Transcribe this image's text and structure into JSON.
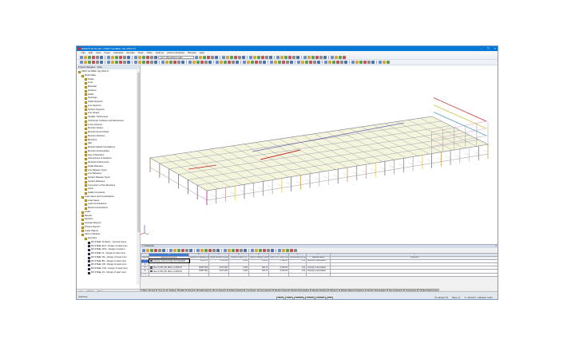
{
  "window": {
    "title": "RFEM 5.22.01 x64 - [ORZY-GLOBAL July 2019 A*]",
    "controls": [
      "–",
      "❐",
      "✕"
    ]
  },
  "menu": [
    "File",
    "Edit",
    "View",
    "Insert",
    "Calculate",
    "Results",
    "Tools",
    "Table",
    "Options",
    "Add-on Modules",
    "Window",
    "Help"
  ],
  "toolbar": {
    "load_case": "LC7 - Permanent Loads"
  },
  "navigator": {
    "title": "Project Navigator - Data",
    "items": [
      {
        "label": "ORZY-GLOBAL July 2019 A*",
        "level": 0,
        "type": "root"
      },
      {
        "label": "Model Data",
        "level": 1
      },
      {
        "label": "Nodes",
        "level": 2
      },
      {
        "label": "Lines",
        "level": 2
      },
      {
        "label": "Materials",
        "level": 2
      },
      {
        "label": "Surfaces",
        "level": 2
      },
      {
        "label": "Solids",
        "level": 2
      },
      {
        "label": "Openings",
        "level": 2
      },
      {
        "label": "Nodal Supports",
        "level": 2
      },
      {
        "label": "Line Supports",
        "level": 2
      },
      {
        "label": "Surface Supports",
        "level": 2
      },
      {
        "label": "Line Hinges",
        "level": 2
      },
      {
        "label": "Variable Thicknesses",
        "level": 2
      },
      {
        "label": "Orthotropic Surfaces and Membranes",
        "level": 2
      },
      {
        "label": "Cross-Sections",
        "level": 2
      },
      {
        "label": "Member Hinges",
        "level": 2
      },
      {
        "label": "Member Eccentricities",
        "level": 2
      },
      {
        "label": "Member Divisions",
        "level": 2
      },
      {
        "label": "Members",
        "level": 2
      },
      {
        "label": "Ribs",
        "level": 2
      },
      {
        "label": "Member Elastic Foundations",
        "level": 2
      },
      {
        "label": "Member Nonlinearities",
        "level": 2
      },
      {
        "label": "Sets of Members",
        "level": 2
      },
      {
        "label": "Intersections of Surfaces",
        "level": 2
      },
      {
        "label": "FE Mesh Refinements",
        "level": 2
      },
      {
        "label": "Nodal Releases",
        "level": 2
      },
      {
        "label": "Line Release Types",
        "level": 2
      },
      {
        "label": "Line Releases",
        "level": 2
      },
      {
        "label": "Surface Release Types",
        "level": 2
      },
      {
        "label": "Surface Releases",
        "level": 2
      },
      {
        "label": "Connection of Two Members",
        "level": 2
      },
      {
        "label": "Joints",
        "level": 2
      },
      {
        "label": "Nodal Constraints",
        "level": 2
      },
      {
        "label": "Load Cases and Combinations",
        "level": 1
      },
      {
        "label": "Load Cases",
        "level": 2
      },
      {
        "label": "Load Combinations",
        "level": 2
      },
      {
        "label": "Result Combinations",
        "level": 2
      },
      {
        "label": "Loads",
        "level": 1
      },
      {
        "label": "Results",
        "level": 1
      },
      {
        "label": "Sections",
        "level": 1
      },
      {
        "label": "Average Regions",
        "level": 1
      },
      {
        "label": "Printout Reports",
        "level": 1
      },
      {
        "label": "Guide Objects",
        "level": 1
      },
      {
        "label": "Add-on Modules",
        "level": 1
      },
      {
        "label": "Favorites",
        "level": 2
      },
      {
        "label": "RF-STEEL Surfaces - General stress",
        "level": 3,
        "type": "module"
      },
      {
        "label": "RF-STEEL EC3 - Design of steel mem",
        "level": 3,
        "type": "module"
      },
      {
        "label": "RF-STEEL AISC - Design of steel m",
        "level": 3,
        "type": "module"
      },
      {
        "label": "RF-STEEL IS - Design of steel mem",
        "level": 3,
        "type": "module"
      },
      {
        "label": "RF-STEEL SIA - Design of steel mem",
        "level": 3,
        "type": "module"
      },
      {
        "label": "RF-STEEL BS - Design of steel mem",
        "level": 3,
        "type": "module"
      },
      {
        "label": "RF-STEEL GB - Design of steel mem",
        "level": 3,
        "type": "module"
      },
      {
        "label": "RF-STEEL CSA - Design of steel mem",
        "level": 3,
        "type": "module"
      },
      {
        "label": "RF-STEEL AS - Design of steel mem",
        "level": 3,
        "type": "module"
      }
    ],
    "tabs": [
      "Data",
      "Display",
      "Views"
    ]
  },
  "table_panel": {
    "title": "1.3 Materials",
    "close": "✕",
    "col_letters": [
      "A",
      "B",
      "C",
      "D",
      "E",
      "F",
      "G",
      "H",
      "I"
    ],
    "headers": [
      "Material No.",
      "Material Description",
      "Modulus of Elasticity E [ksi]",
      "Shear Modulus G [ksi]",
      "Poisson's Ratio ν [-]",
      "Specific Weight γ [lbf/ft³]",
      "Coeff. of Th. Exp. α [1/°F]",
      "Partial Factor γM [-]",
      "Material Model",
      "Comment"
    ],
    "rows": [
      {
        "no": "1",
        "desc": "Concrete 3.00 (f'c 3.00) | ACI 318-2005",
        "E": "4156.975",
        "G": "1731.240",
        "nu": "0.200",
        "w": "150.00",
        "alpha": "5.56E-06",
        "gm": "1.00",
        "model": "Isotropic Linear Elastic",
        "comment": "",
        "color": "#ffffff"
      },
      {
        "no": "2",
        "desc": "",
        "E": "",
        "G": "",
        "nu": "",
        "w": "",
        "alpha": "",
        "gm": "",
        "model": "",
        "comment": "",
        "color": ""
      },
      {
        "no": "3",
        "desc": "Steel S 235 | EN 1993-1-1:2005-05",
        "E": "30457.500",
        "G": "11714.400",
        "nu": "0.300",
        "w": "490.72",
        "alpha": "6.67E-06",
        "gm": "1.00",
        "model": "Isotropic Linear Elastic",
        "comment": "",
        "color": "#7a68d8"
      },
      {
        "no": "4",
        "desc": "Steel S 355 | EN 1993-1-1:2005-05",
        "E": "30457.500",
        "G": "11714.400",
        "nu": "0.300",
        "w": "490.72",
        "alpha": "6.67E-06",
        "gm": "1.00",
        "model": "Isotropic Linear Elastic",
        "comment": "",
        "color": "#1a2a9a"
      },
      {
        "no": "5",
        "desc": "",
        "E": "",
        "G": "",
        "nu": "",
        "w": "",
        "alpha": "",
        "gm": "",
        "model": "",
        "comment": "",
        "color": ""
      }
    ],
    "sheet_tabs": [
      "Nodes",
      "Lines",
      "Materials",
      "Surfaces",
      "Solids",
      "Openings",
      "Nodal Supports",
      "Line Supports",
      "Surface Supports",
      "Line Hinges",
      "Cross-Sections",
      "Member Hinges",
      "Member Eccentricities",
      "Member Divisions",
      "Members",
      "Member Elastic Foundations",
      "Member Nonlinearities",
      "Sets of Members",
      "Intersections",
      "FE Mesh Refinements"
    ],
    "active_tab": "Materials"
  },
  "status": {
    "left": "Grid Point",
    "buttons": [
      "SNAP",
      "GRID",
      "CARTES",
      "OSNAP",
      "GLINES",
      "DXF"
    ],
    "cs": "CS: Global XYZ",
    "plane": "Plane: XY",
    "coords": "X: -134.318  Y: -128.904  Z: 0.00 ft"
  },
  "colors": {
    "titlebar": "#0078d7",
    "selection": "#2d6ed0"
  }
}
